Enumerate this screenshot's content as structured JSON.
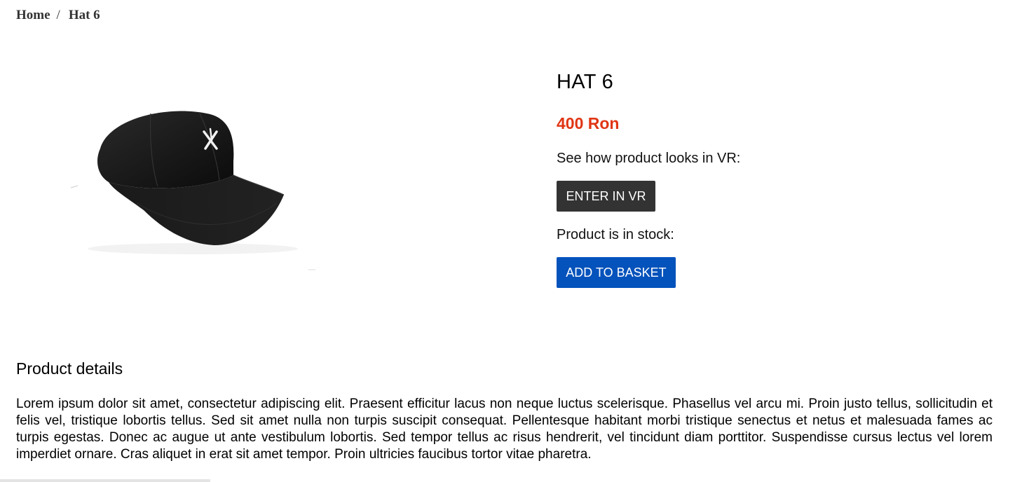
{
  "breadcrumb": {
    "home": "Home",
    "separator": "/",
    "current": "Hat 6"
  },
  "product": {
    "title": "HAT 6",
    "price": "400 Ron",
    "image_icon": "black-baseball-cap-image",
    "vr_label": "See how product looks in VR:",
    "vr_button": "ENTER IN VR",
    "stock_label": "Product is in stock:",
    "basket_button": "ADD TO BASKET"
  },
  "details": {
    "title": "Product details",
    "text": "Lorem ipsum dolor sit amet, consectetur adipiscing elit. Praesent efficitur lacus non neque luctus scelerisque. Phasellus vel arcu mi. Proin justo tellus, sollicitudin et felis vel, tristique lobortis tellus. Sed sit amet nulla non turpis suscipit consequat. Pellentesque habitant morbi tristique senectus et netus et malesuada fames ac turpis egestas. Donec ac augue ut ante vestibulum lobortis. Sed tempor tellus ac risus hendrerit, vel tincidunt diam porttitor. Suspendisse cursus lectus vel lorem imperdiet ornare. Cras aliquet in erat sit amet tempor. Proin ultricies faucibus tortor vitae pharetra."
  },
  "colors": {
    "price": "#e03514",
    "vr_button_bg": "#333333",
    "basket_button_bg": "#0452bb"
  }
}
